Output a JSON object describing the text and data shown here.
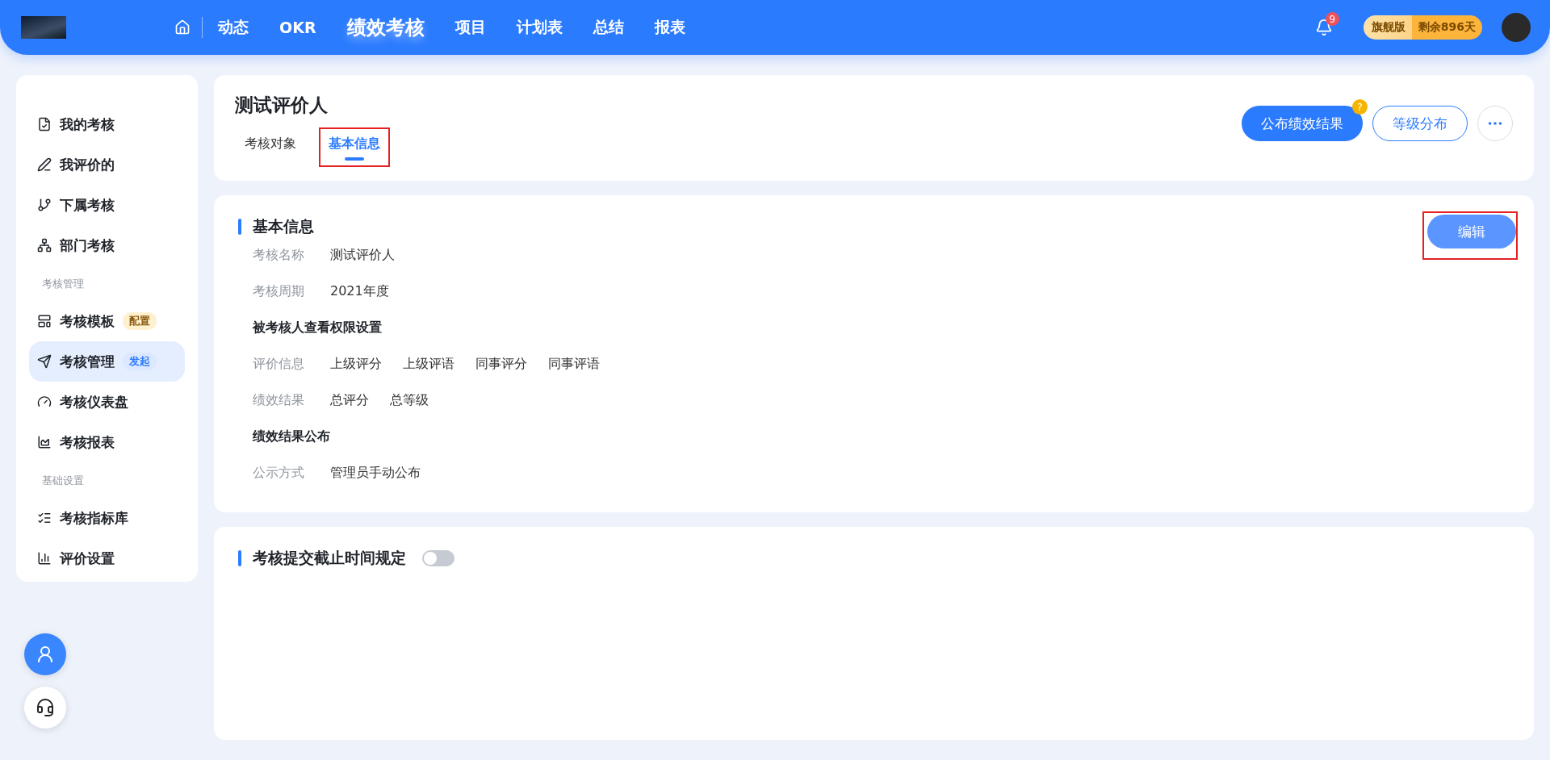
{
  "topbar": {
    "nav": [
      {
        "label": "动态",
        "selected": false
      },
      {
        "label": "OKR",
        "selected": false
      },
      {
        "label": "绩效考核",
        "selected": true
      },
      {
        "label": "项目",
        "selected": false
      },
      {
        "label": "计划表",
        "selected": false
      },
      {
        "label": "总结",
        "selected": false
      },
      {
        "label": "报表",
        "selected": false
      }
    ],
    "notification_count": "9",
    "plan": {
      "edition": "旗舰版",
      "remaining": "剩余896天"
    }
  },
  "sidebar": {
    "groups": [
      {
        "items": [
          {
            "label": "我的考核",
            "selected": false
          },
          {
            "label": "我评价的",
            "selected": false
          },
          {
            "label": "下属考核",
            "selected": false
          },
          {
            "label": "部门考核",
            "selected": false
          }
        ]
      },
      {
        "heading": "考核管理",
        "items": [
          {
            "label": "考核模板",
            "selected": false,
            "badge": {
              "text": "配置",
              "kind": "warn"
            }
          },
          {
            "label": "考核管理",
            "selected": true,
            "badge": {
              "text": "发起",
              "kind": "info"
            }
          },
          {
            "label": "考核仪表盘",
            "selected": false
          },
          {
            "label": "考核报表",
            "selected": false
          }
        ]
      },
      {
        "heading": "基础设置",
        "items": [
          {
            "label": "考核指标库",
            "selected": false
          },
          {
            "label": "评价设置",
            "selected": false
          }
        ]
      }
    ]
  },
  "header": {
    "title": "测试评价人",
    "tabs": [
      {
        "label": "考核对象",
        "selected": false,
        "highlighted": false
      },
      {
        "label": "基本信息",
        "selected": true,
        "highlighted": true
      }
    ],
    "actions": {
      "publish": "公布绩效结果",
      "help": "?",
      "distribution": "等级分布"
    }
  },
  "basic_info": {
    "title": "基本信息",
    "edit": {
      "label": "编辑",
      "highlighted": true
    },
    "rows": [
      {
        "kind": "field",
        "label": "考核名称",
        "values": [
          "测试评价人"
        ]
      },
      {
        "kind": "field",
        "label": "考核周期",
        "values": [
          "2021年度"
        ]
      },
      {
        "kind": "heading",
        "label": "被考核人查看权限设置"
      },
      {
        "kind": "field",
        "label": "评价信息",
        "values": [
          "上级评分",
          "上级评语",
          "同事评分",
          "同事评语"
        ]
      },
      {
        "kind": "field",
        "label": "绩效结果",
        "values": [
          "总评分",
          "总等级"
        ]
      },
      {
        "kind": "heading",
        "label": "绩效结果公布"
      },
      {
        "kind": "field",
        "label": "公示方式",
        "values": [
          "管理员手动公布"
        ]
      }
    ]
  },
  "deadline": {
    "title": "考核提交截止时间规定",
    "on": false
  }
}
